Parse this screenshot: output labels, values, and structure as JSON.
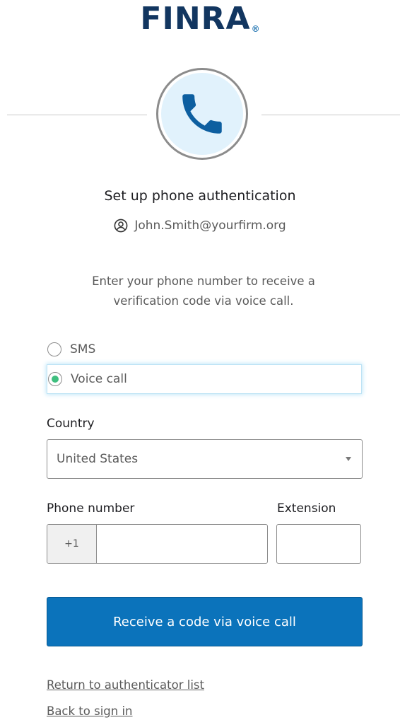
{
  "brand": {
    "logo_text": "FINRA",
    "logo_mark": "®"
  },
  "header": {
    "icon": "phone-icon",
    "title": "Set up phone authentication",
    "identity_icon": "user-icon",
    "username": "John.Smith@yourfirm.org"
  },
  "instructions": "Enter your phone number to receive a verification code via voice call.",
  "method": {
    "options": [
      {
        "label": "SMS",
        "selected": false
      },
      {
        "label": "Voice call",
        "selected": true
      }
    ]
  },
  "country": {
    "label": "Country",
    "value": "United States"
  },
  "phone": {
    "label": "Phone number",
    "prefix": "+1",
    "value": ""
  },
  "extension": {
    "label": "Extension",
    "value": ""
  },
  "submit": {
    "label": "Receive a code via voice call"
  },
  "links": {
    "return": "Return to authenticator list",
    "back": "Back to sign in"
  },
  "colors": {
    "brand_navy": "#123660",
    "primary_button": "#0b73bb",
    "radio_selected": "#3fbf7f",
    "icon_bg": "#e1f2fc"
  }
}
